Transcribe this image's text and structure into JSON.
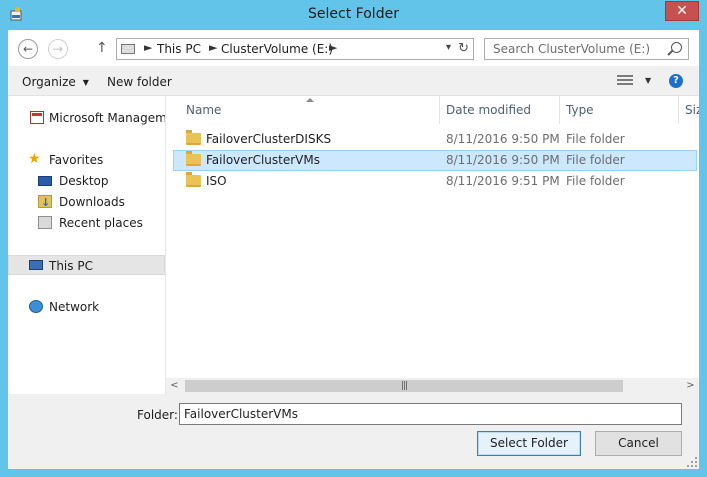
{
  "window": {
    "title": "Select Folder",
    "close_glyph": "✕"
  },
  "nav": {
    "back_glyph": "←",
    "forward_glyph": "→",
    "up_glyph": "↑",
    "address": [
      "This PC",
      "ClusterVolume (E:)"
    ],
    "address_sep": "►",
    "address_drop_glyph": "▾",
    "refresh_glyph": "↻",
    "search_placeholder": "Search ClusterVolume (E:)"
  },
  "toolbar": {
    "organize_label": "Organize",
    "new_folder_label": "New folder",
    "caret_glyph": "▼",
    "help_glyph": "?"
  },
  "sidebar": {
    "items": [
      {
        "label": "Microsoft Management Console",
        "icon": "mmc-icon"
      },
      {
        "label": "Favorites",
        "icon": "star-icon"
      },
      {
        "label": "Desktop",
        "icon": "desktop-icon"
      },
      {
        "label": "Downloads",
        "icon": "downloads-icon"
      },
      {
        "label": "Recent places",
        "icon": "recent-places-icon"
      },
      {
        "label": "This PC",
        "icon": "computer-icon"
      },
      {
        "label": "Network",
        "icon": "network-icon"
      }
    ],
    "star_glyph": "★"
  },
  "columns": {
    "name": "Name",
    "date": "Date modified",
    "type": "Type",
    "size": "Size"
  },
  "files": [
    {
      "name": "FailoverClusterDISKS",
      "date": "8/11/2016 9:50 PM",
      "type": "File folder"
    },
    {
      "name": "FailoverClusterVMs",
      "date": "8/11/2016 9:50 PM",
      "type": "File folder"
    },
    {
      "name": "ISO",
      "date": "8/11/2016 9:51 PM",
      "type": "File folder"
    }
  ],
  "scrollbar": {
    "left_glyph": "<",
    "right_glyph": ">",
    "grip_glyph": "|||"
  },
  "footer": {
    "folder_label": "Folder:",
    "folder_value": "FailoverClusterVMs",
    "select_button": "Select Folder",
    "cancel_button": "Cancel"
  }
}
